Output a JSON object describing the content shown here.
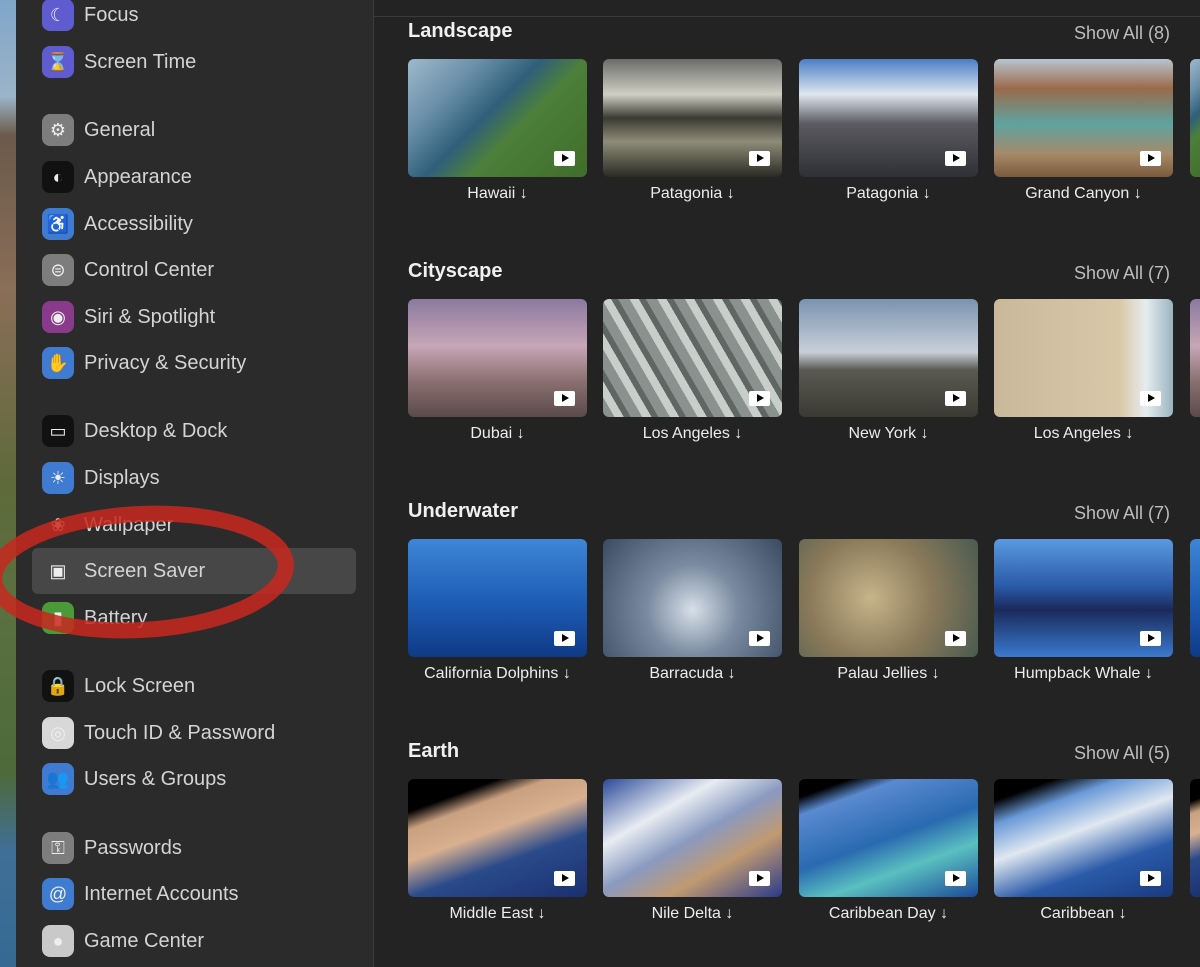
{
  "sidebar": {
    "selected": "Screen Saver",
    "items": [
      {
        "label": "Focus",
        "icon": "moon-icon",
        "color": "#5e5ccf",
        "glyph": "☾"
      },
      {
        "label": "Screen Time",
        "icon": "hourglass-icon",
        "color": "#5e5ccf",
        "glyph": "⌛"
      },
      {
        "label": "General",
        "icon": "gear-icon",
        "color": "#7d7d7d",
        "glyph": "⚙"
      },
      {
        "label": "Appearance",
        "icon": "appearance-icon",
        "color": "#111111",
        "glyph": "◐"
      },
      {
        "label": "Accessibility",
        "icon": "accessibility-icon",
        "color": "#3f7bd0",
        "glyph": "♿"
      },
      {
        "label": "Control Center",
        "icon": "toggles-icon",
        "color": "#7d7d7d",
        "glyph": "⊜"
      },
      {
        "label": "Siri & Spotlight",
        "icon": "siri-icon",
        "color": "#8a3a8a",
        "glyph": "◉"
      },
      {
        "label": "Privacy & Security",
        "icon": "hand-icon",
        "color": "#3f7bd0",
        "glyph": "✋"
      },
      {
        "label": "Desktop & Dock",
        "icon": "dock-icon",
        "color": "#111111",
        "glyph": "▭"
      },
      {
        "label": "Displays",
        "icon": "sun-icon",
        "color": "#3f7bd0",
        "glyph": "☀"
      },
      {
        "label": "Wallpaper",
        "icon": "flower-icon",
        "color": "#2b2b2b",
        "glyph": "❀"
      },
      {
        "label": "Screen Saver",
        "icon": "screensaver-icon",
        "color": "transparent",
        "glyph": "▣"
      },
      {
        "label": "Battery",
        "icon": "battery-icon",
        "color": "#4a9a3a",
        "glyph": "▮"
      },
      {
        "label": "Lock Screen",
        "icon": "lock-icon",
        "color": "#111111",
        "glyph": "🔒"
      },
      {
        "label": "Touch ID & Password",
        "icon": "fingerprint-icon",
        "color": "#d8d8d8",
        "glyph": "◎"
      },
      {
        "label": "Users & Groups",
        "icon": "users-icon",
        "color": "#3f7bd0",
        "glyph": "👥"
      },
      {
        "label": "Passwords",
        "icon": "key-icon",
        "color": "#7d7d7d",
        "glyph": "⚿"
      },
      {
        "label": "Internet Accounts",
        "icon": "at-icon",
        "color": "#3f7bd0",
        "glyph": "@"
      },
      {
        "label": "Game Center",
        "icon": "game-center-icon",
        "color": "#c9c9c9",
        "glyph": "●"
      }
    ]
  },
  "sections": [
    {
      "title": "Landscape",
      "show_all": "Show All (8)",
      "items": [
        {
          "name": "Hawaii ↓",
          "bg": "linear-gradient(135deg,#9fb9cc 0%,#6a8fa8 25%,#2f5f7a 45%,#4c7f3a 60%,#3f6e2a 100%)"
        },
        {
          "name": "Patagonia ↓",
          "bg": "linear-gradient(180deg,#6b6b6b 0%,#cfcfc4 30%,#3a3a34 50%,#8e8c78 70%,#2a2a24 100%)"
        },
        {
          "name": "Patagonia ↓",
          "bg": "linear-gradient(180deg,#4a7fc4 0%,#dfe6ee 30%,#5a5a60 55%,#2f2f36 100%)"
        },
        {
          "name": "Grand Canyon ↓",
          "bg": "linear-gradient(180deg,#b9c4cf 0%,#9a6a4a 25%,#5fa3a0 55%,#a58a6a 80%,#7a5a3a 100%)"
        }
      ]
    },
    {
      "title": "Cityscape",
      "show_all": "Show All (7)",
      "items": [
        {
          "name": "Dubai ↓",
          "bg": "linear-gradient(180deg,#8a7aa0 0%,#c7a6b6 40%,#8a6f70 70%,#5a4a4a 100%)"
        },
        {
          "name": "Los Angeles ↓",
          "bg": "repeating-linear-gradient(60deg,#8a9290 0 10px,#c9cecb 10px 18px,#5f6664 18px 24px)"
        },
        {
          "name": "New York ↓",
          "bg": "linear-gradient(180deg,#7a93b0 0%,#c8d0d8 45%,#5a5a52 60%,#3a3a32 100%)"
        },
        {
          "name": "Los Angeles ↓",
          "bg": "linear-gradient(90deg,#c9b89a 0%,#d9c8a8 70%,#e6ecee 85%,#9ab4c0 100%)"
        }
      ]
    },
    {
      "title": "Underwater",
      "show_all": "Show All (7)",
      "items": [
        {
          "name": "California Dolphins ↓",
          "bg": "linear-gradient(180deg,#3f86d6 0%,#1f5fb8 50%,#0f3a86 100%)"
        },
        {
          "name": "Barracuda ↓",
          "bg": "radial-gradient(circle at 50% 60%,#d8e0e8 0%,#7a8aa0 40%,#3a4a60 100%)"
        },
        {
          "name": "Palau Jellies ↓",
          "bg": "radial-gradient(circle at 40% 50%,#c6b48a 0%,#8a7a5a 50%,#4a5a50 100%)"
        },
        {
          "name": "Humpback Whale ↓",
          "bg": "linear-gradient(180deg,#5a9ae0 0%,#2a5aa8 40%,#1a2a5a 60%,#3a7ad0 100%)"
        }
      ]
    },
    {
      "title": "Earth",
      "show_all": "Show All (5)",
      "items": [
        {
          "name": "Middle East ↓",
          "bg": "linear-gradient(160deg,#000 0%,#000 18%,#c9a080 28%,#d8b090 45%,#2a4a8a 65%,#1a3070 100%)"
        },
        {
          "name": "Nile Delta ↓",
          "bg": "linear-gradient(150deg,#2a4a9a 0%,#e8ecf2 30%,#8a9ac0 50%,#c09a70 70%,#2a3a8a 100%)"
        },
        {
          "name": "Caribbean Day ↓",
          "bg": "linear-gradient(160deg,#000 0%,#000 10%,#5a8ad0 20%,#2a6ab0 50%,#5ac0c0 70%,#1a4a9a 100%)"
        },
        {
          "name": "Caribbean ↓",
          "bg": "linear-gradient(160deg,#000 0%,#000 12%,#6a9ad8 25%,#e0e8f0 45%,#2a5aa8 70%,#1a3a80 100%)"
        }
      ]
    }
  ],
  "annotation": {
    "color": "#d0281e",
    "shape": "hand-drawn ellipse around Screen Saver"
  }
}
